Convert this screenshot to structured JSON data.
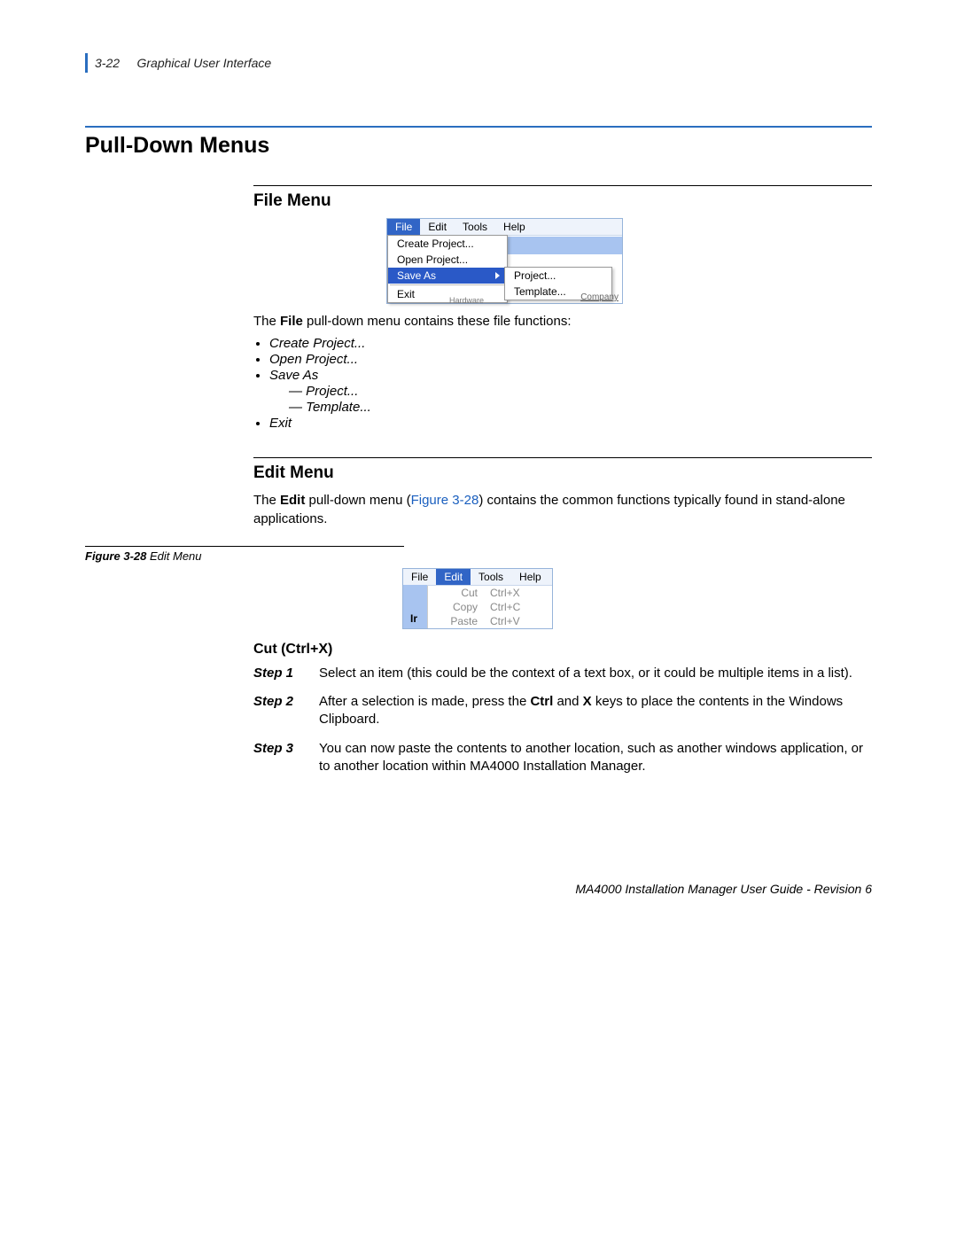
{
  "header": {
    "page": "3-22",
    "chapter": "Graphical User Interface"
  },
  "section_title": "Pull-Down Menus",
  "file_menu": {
    "heading": "File Menu",
    "intro_a": "The ",
    "intro_bold": "File",
    "intro_b": " pull-down menu contains these file functions:",
    "items": {
      "create": "Create Project...",
      "open": "Open Project...",
      "saveas": "Save As",
      "project": "Project...",
      "template": "Template...",
      "exit": "Exit"
    },
    "shot": {
      "menubar": {
        "file": "File",
        "edit": "Edit",
        "tools": "Tools",
        "help": "Help"
      },
      "dd": {
        "create": "Create Project...",
        "open": "Open Project...",
        "saveas": "Save As",
        "exit": "Exit"
      },
      "sub": {
        "project": "Project...",
        "template": "Template..."
      },
      "company": "Company",
      "hardware": "Hardware"
    }
  },
  "edit_menu": {
    "heading": "Edit Menu",
    "intro_a": "The ",
    "intro_bold": "Edit",
    "intro_b": " pull-down menu (",
    "fig_link": "Figure 3-28",
    "intro_c": ") contains the common functions typically found in stand-alone applications.",
    "caption_label": "Figure 3-28",
    "caption_text": "  Edit Menu",
    "shot": {
      "menubar": {
        "file": "File",
        "edit": "Edit",
        "tools": "Tools",
        "help": "Help"
      },
      "cut": {
        "label": "Cut",
        "sc": "Ctrl+X"
      },
      "copy": {
        "label": "Copy",
        "sc": "Ctrl+C"
      },
      "paste": {
        "label": "Paste",
        "sc": "Ctrl+V"
      },
      "ir": "Ir"
    },
    "cut_heading": "Cut (Ctrl+X)",
    "steps": {
      "s1_label": "Step 1",
      "s1_text": "Select an item (this could be the context of a text box, or it could be multiple items in a list).",
      "s2_label": "Step 2",
      "s2_text_a": "After a selection is made, press the ",
      "s2_bold1": "Ctrl",
      "s2_text_b": " and ",
      "s2_bold2": "X",
      "s2_text_c": " keys to place the contents in the Windows Clipboard.",
      "s3_label": "Step 3",
      "s3_text": "You can now paste the contents to another location, such as another windows application, or to another location within MA4000 Installation Manager."
    }
  },
  "footer": "MA4000 Installation Manager User Guide - Revision 6"
}
